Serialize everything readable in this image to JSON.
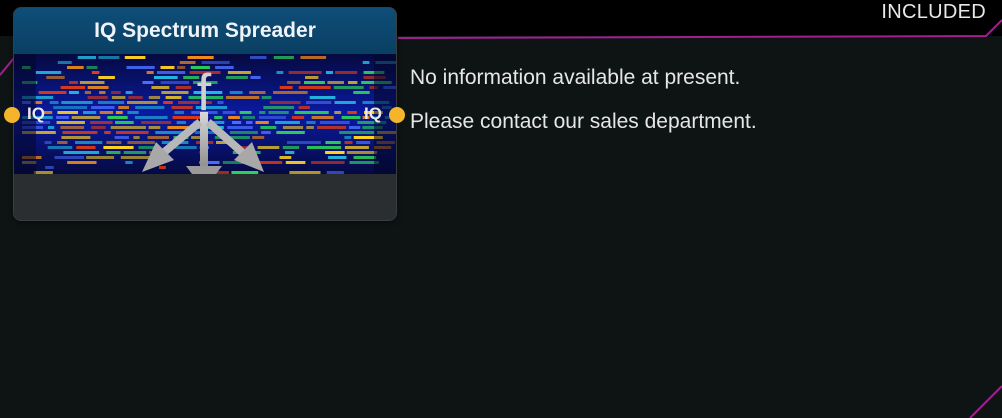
{
  "badge": {
    "label": "INCLUDED"
  },
  "node": {
    "title": "IQ Spectrum Spreader",
    "icon": "spectrum-spread-icon",
    "input_port": {
      "label": "IQ",
      "color": "#f5b52b"
    },
    "output_port": {
      "label": "IQ",
      "color": "#f5b52b"
    }
  },
  "info": {
    "lines": [
      "No information available at present.",
      "Please contact our sales department."
    ]
  },
  "colors": {
    "background": "#0e1414",
    "topbar": "#000000",
    "accent": "#a0208f",
    "header": "#0d4a73"
  }
}
